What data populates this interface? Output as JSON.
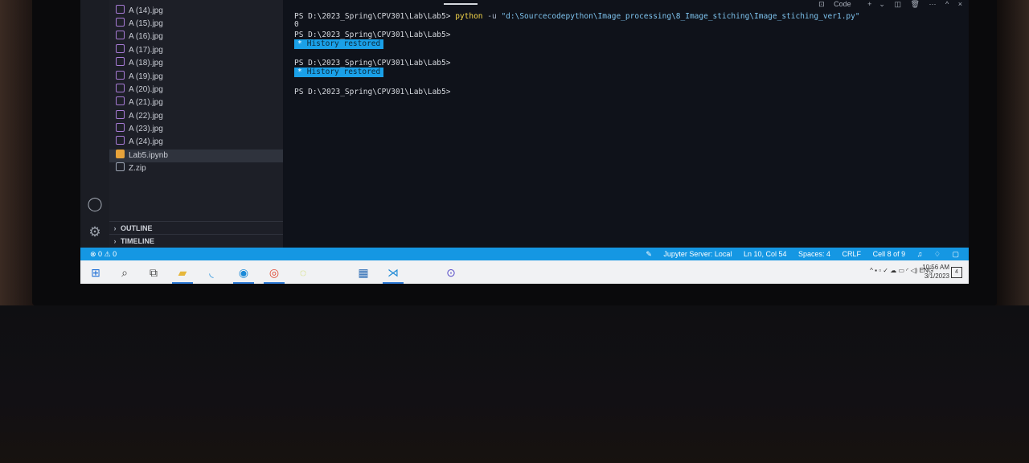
{
  "explorer": {
    "files": [
      {
        "name": "A (14).jpg",
        "kind": "image"
      },
      {
        "name": "A (15).jpg",
        "kind": "image"
      },
      {
        "name": "A (16).jpg",
        "kind": "image"
      },
      {
        "name": "A (17).jpg",
        "kind": "image"
      },
      {
        "name": "A (18).jpg",
        "kind": "image"
      },
      {
        "name": "A (19).jpg",
        "kind": "image"
      },
      {
        "name": "A (20).jpg",
        "kind": "image"
      },
      {
        "name": "A (21).jpg",
        "kind": "image"
      },
      {
        "name": "A (22).jpg",
        "kind": "image"
      },
      {
        "name": "A (23).jpg",
        "kind": "image"
      },
      {
        "name": "A (24).jpg",
        "kind": "image"
      },
      {
        "name": "Lab5.ipynb",
        "kind": "notebook"
      },
      {
        "name": "Z.zip",
        "kind": "zip"
      }
    ],
    "outline_label": "OUTLINE",
    "timeline_label": "TIMELINE"
  },
  "terminal": {
    "toolbar": {
      "code_label": "Code",
      "plus": "+",
      "chevron": "⌄",
      "split": "◫",
      "trash": "🗑",
      "more": "···",
      "maximize": "^",
      "close": "×"
    },
    "prompt": "PS D:\\2023_Spring\\CPV301\\Lab\\Lab5>",
    "command": "python",
    "flag": "-u",
    "path": "\"d:\\Sourcecodepython\\Image_processing\\8_Image_stiching\\Image_stiching_ver1.py\"",
    "output": "0",
    "restored_marker": "*",
    "restored_text": "History restored"
  },
  "statusbar": {
    "problems": "⊗ 0 ⚠ 0",
    "jupyter": "Jupyter Server: Local",
    "position": "Ln 10, Col 54",
    "spaces": "Spaces: 4",
    "eol": "CRLF",
    "cell": "Cell 8 of 9"
  },
  "taskbar": {
    "tray_lang": "ENG",
    "time": "10:56 AM",
    "date": "3/1/2023",
    "notification_count": "4"
  },
  "colors": {
    "statusbar": "#1597e3",
    "terminal_bg": "#0f121a",
    "command": "#f5d64a",
    "restored_bg": "#1aa0e8"
  }
}
